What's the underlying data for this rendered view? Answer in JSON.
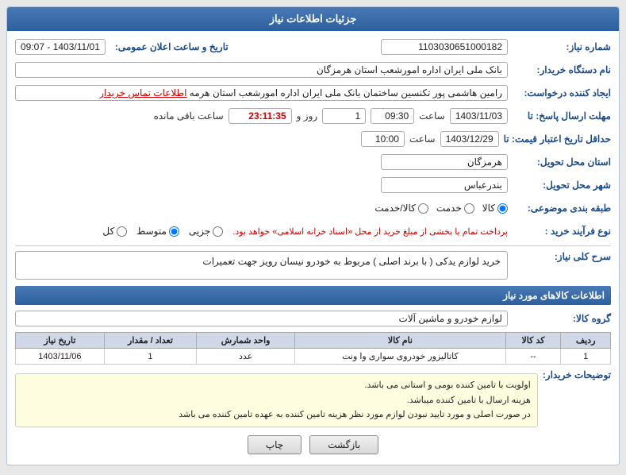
{
  "header": {
    "title": "جزئیات اطلاعات نیاز"
  },
  "fields": {
    "need_number_label": "شماره نیاز:",
    "need_number_value": "1103030651000182",
    "datetime_label": "تاریخ و ساعت اعلان عمومی:",
    "datetime_value": "1403/11/01 - 09:07",
    "buyer_org_label": "نام دستگاه خریدار:",
    "buyer_org_value": "بانک ملی ایران اداره امورشعب استان هرمزگان",
    "creator_label": "ایجاد کننده درخواست:",
    "creator_value": "رامین هاشمی پور تکنسین ساختمان بانک ملی ایران اداره امورشعب استان هرمه",
    "creator_link": "اطلاعات تماس خریدار",
    "response_deadline_label": "مهلت ارسال پاسخ: تا",
    "response_deadline_date": "1403/11/03",
    "response_deadline_time": "09:30",
    "response_deadline_days": "1",
    "response_deadline_remaining": "23:11:35",
    "validity_label": "حداقل تاریخ اعتبار قیمت: تا",
    "validity_date": "1403/12/29",
    "validity_time": "10:00",
    "province_label": "استان محل تحویل:",
    "province_value": "هرمزگان",
    "city_label": "شهر محل تحویل:",
    "city_value": "بندرعباس",
    "category_label": "طبقه بندی موضوعی:",
    "category_options": [
      "کالا",
      "خدمت",
      "کالا/خدمت"
    ],
    "category_selected": "کالا",
    "purchase_type_label": "نوع فرآیند خرید :",
    "purchase_type_note": "پرداخت تمام یا بخشی از مبلغ خرید از محل «اسناد خزانه اسلامی» خواهد بود.",
    "purchase_options": [
      "جزیی",
      "متوسط",
      "کل"
    ],
    "purchase_selected": "متوسط",
    "description_label": "سرح کلی نیاز:",
    "description_value": "خرید لوازم یدکی ( با برند اصلی ) مربوط به خودرو نیسان رویز جهت تعمیرات",
    "goods_section": "اطلاعات کالاهای مورد نیاز",
    "goods_group_label": "گروه کالا:",
    "goods_group_value": "لوازم خودرو و ماشین آلات",
    "table_headers": [
      "ردیف",
      "کد کالا",
      "نام کالا",
      "واحد شمارش",
      "تعداد / مقدار",
      "تاریخ نیاز"
    ],
    "table_rows": [
      {
        "row": "1",
        "code": "--",
        "name": "کاتالیزور خودروی سواری وا ونت",
        "unit": "عدد",
        "quantity": "1",
        "date": "1403/11/06"
      }
    ],
    "buyer_notes_label": "توضیحات خریدار:",
    "buyer_notes_lines": [
      "اولویت با تامین کننده بومی و استانی می باشد.",
      "هزینه ارسال با تامین کننده میباشد.",
      "در صورت اصلی و مورد تایید نبودن لوازم مورد نظر هزینه تامین کننده به عهده تامین کننده می باشد"
    ],
    "btn_back": "بازگشت",
    "btn_print": "چاپ",
    "day_label": "روز و",
    "hour_label": "ساعت",
    "remaining_label": "ساعت باقی مانده"
  }
}
